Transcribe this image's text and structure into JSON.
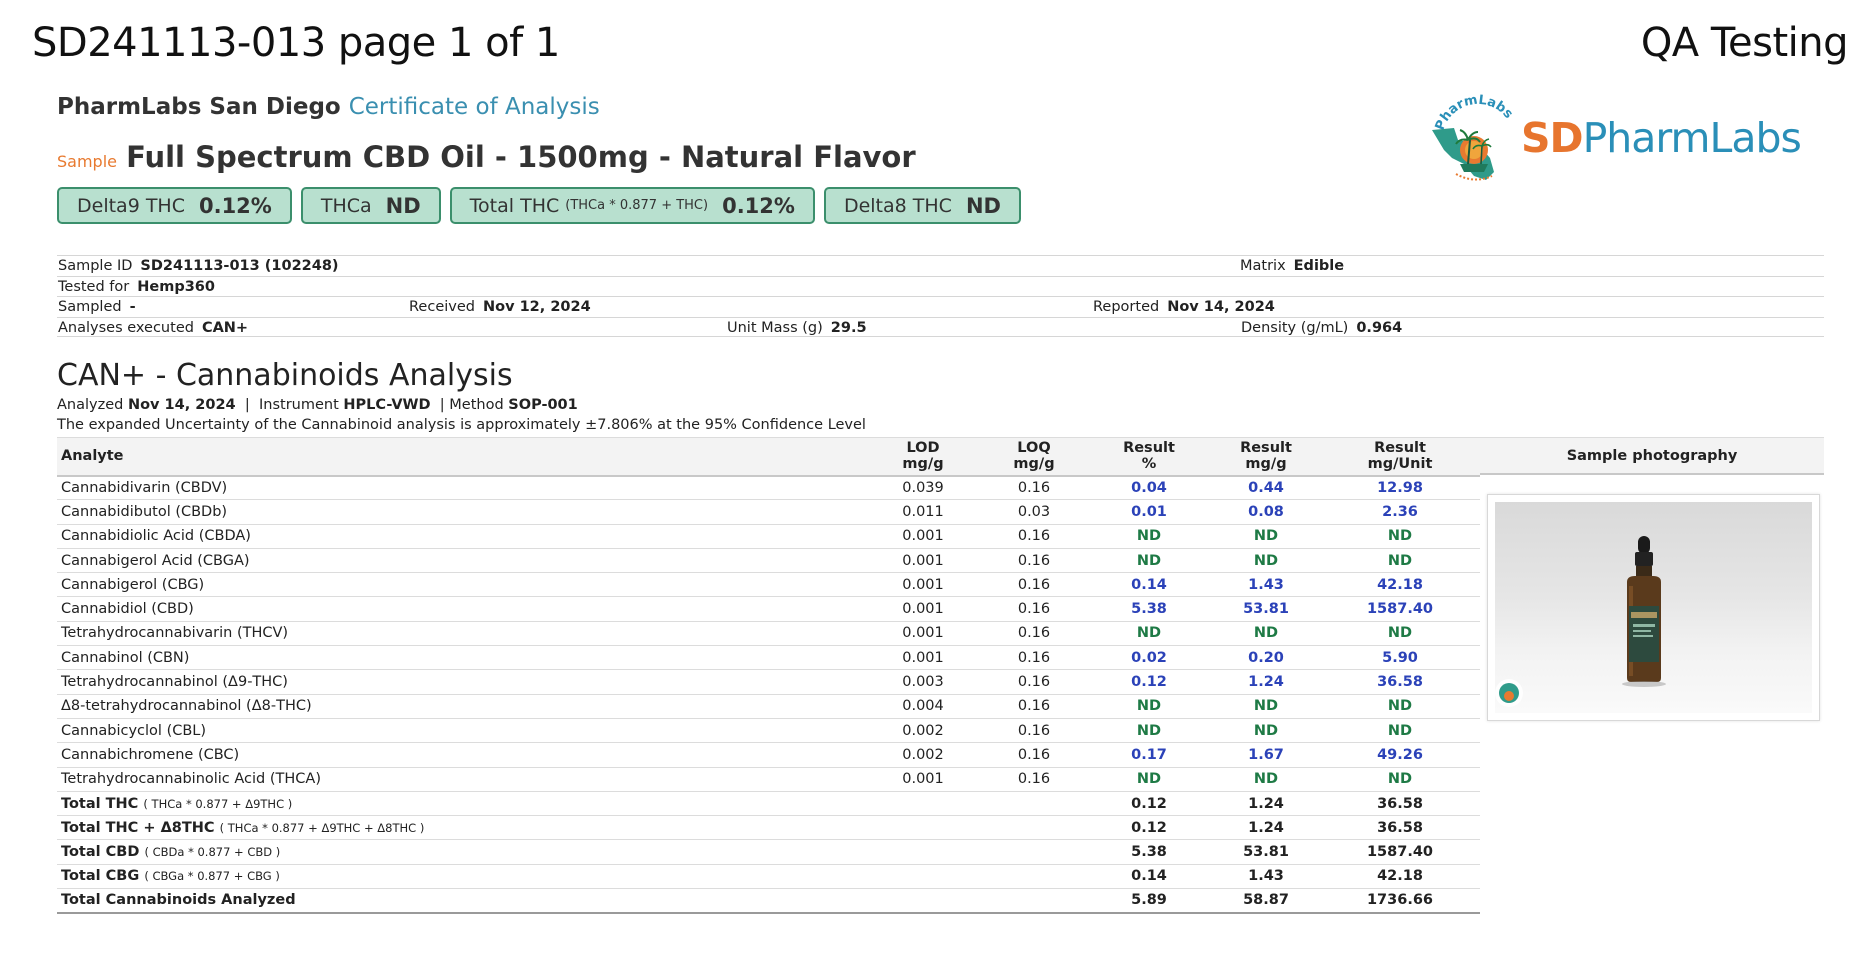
{
  "header": {
    "doc_title": "SD241113-013 page 1 of 1",
    "right_title": "QA Testing",
    "lab_name": "PharmLabs San Diego",
    "doc_type": "Certificate of Analysis",
    "sample_tag": "Sample",
    "sample_name": "Full Spectrum CBD Oil - 1500mg - Natural Flavor"
  },
  "logo": {
    "sd": "SD",
    "pharm": "PharmLabs",
    "arc_text": "PharmLabs"
  },
  "badges": [
    {
      "label": "Delta9 THC",
      "formula": "",
      "value": "0.12%"
    },
    {
      "label": "THCa",
      "formula": "",
      "value": "ND"
    },
    {
      "label": "Total THC",
      "formula": "(THCa * 0.877 + THC)",
      "value": "0.12%"
    },
    {
      "label": "Delta8 THC",
      "formula": "",
      "value": "ND"
    }
  ],
  "meta": {
    "sample_id_label": "Sample ID",
    "sample_id": "SD241113-013 (102248)",
    "matrix_label": "Matrix",
    "matrix": "Edible",
    "tested_for_label": "Tested for",
    "tested_for": "Hemp360",
    "sampled_label": "Sampled",
    "sampled": "-",
    "received_label": "Received",
    "received": "Nov 12, 2024",
    "reported_label": "Reported",
    "reported": "Nov 14, 2024",
    "analyses_label": "Analyses executed",
    "analyses": "CAN+",
    "unit_mass_label": "Unit Mass (g)",
    "unit_mass": "29.5",
    "density_label": "Density (g/mL)",
    "density": "0.964"
  },
  "analysis": {
    "title": "CAN+ - Cannabinoids Analysis",
    "analyzed_label": "Analyzed",
    "analyzed": "Nov 14, 2024",
    "instrument_label": "Instrument",
    "instrument": "HPLC-VWD",
    "method_label": "Method",
    "method": "SOP-001",
    "uncertainty_text": "The expanded Uncertainty of the Cannabinoid analysis is approximately ±7.806% at the 95% Confidence Level",
    "headers": {
      "analyte": "Analyte",
      "lod1": "LOD",
      "lod2": "mg/g",
      "loq1": "LOQ",
      "loq2": "mg/g",
      "rp1": "Result",
      "rp2": "%",
      "rg1": "Result",
      "rg2": "mg/g",
      "ru1": "Result",
      "ru2": "mg/Unit"
    },
    "photo_header": "Sample photography",
    "rows": [
      {
        "name": "Cannabidivarin (CBDV)",
        "lod": "0.039",
        "loq": "0.16",
        "pct": "0.04",
        "mgg": "0.44",
        "mgu": "12.98"
      },
      {
        "name": "Cannabidibutol (CBDb)",
        "lod": "0.011",
        "loq": "0.03",
        "pct": "0.01",
        "mgg": "0.08",
        "mgu": "2.36"
      },
      {
        "name": "Cannabidiolic Acid (CBDA)",
        "lod": "0.001",
        "loq": "0.16",
        "pct": "ND",
        "mgg": "ND",
        "mgu": "ND"
      },
      {
        "name": "Cannabigerol Acid (CBGA)",
        "lod": "0.001",
        "loq": "0.16",
        "pct": "ND",
        "mgg": "ND",
        "mgu": "ND"
      },
      {
        "name": "Cannabigerol (CBG)",
        "lod": "0.001",
        "loq": "0.16",
        "pct": "0.14",
        "mgg": "1.43",
        "mgu": "42.18"
      },
      {
        "name": "Cannabidiol (CBD)",
        "lod": "0.001",
        "loq": "0.16",
        "pct": "5.38",
        "mgg": "53.81",
        "mgu": "1587.40"
      },
      {
        "name": "Tetrahydrocannabivarin (THCV)",
        "lod": "0.001",
        "loq": "0.16",
        "pct": "ND",
        "mgg": "ND",
        "mgu": "ND"
      },
      {
        "name": "Cannabinol (CBN)",
        "lod": "0.001",
        "loq": "0.16",
        "pct": "0.02",
        "mgg": "0.20",
        "mgu": "5.90"
      },
      {
        "name": "Tetrahydrocannabinol (Δ9-THC)",
        "lod": "0.003",
        "loq": "0.16",
        "pct": "0.12",
        "mgg": "1.24",
        "mgu": "36.58"
      },
      {
        "name": "Δ8-tetrahydrocannabinol (Δ8-THC)",
        "lod": "0.004",
        "loq": "0.16",
        "pct": "ND",
        "mgg": "ND",
        "mgu": "ND"
      },
      {
        "name": "Cannabicyclol (CBL)",
        "lod": "0.002",
        "loq": "0.16",
        "pct": "ND",
        "mgg": "ND",
        "mgu": "ND"
      },
      {
        "name": "Cannabichromene (CBC)",
        "lod": "0.002",
        "loq": "0.16",
        "pct": "0.17",
        "mgg": "1.67",
        "mgu": "49.26"
      },
      {
        "name": "Tetrahydrocannabinolic Acid (THCA)",
        "lod": "0.001",
        "loq": "0.16",
        "pct": "ND",
        "mgg": "ND",
        "mgu": "ND"
      }
    ],
    "totals": [
      {
        "name": "Total THC",
        "formula": "( THCa * 0.877 + Δ9THC )",
        "pct": "0.12",
        "mgg": "1.24",
        "mgu": "36.58"
      },
      {
        "name": "Total THC + Δ8THC",
        "formula": "( THCa * 0.877 + Δ9THC + Δ8THC )",
        "pct": "0.12",
        "mgg": "1.24",
        "mgu": "36.58"
      },
      {
        "name": "Total CBD",
        "formula": "( CBDa * 0.877 + CBD )",
        "pct": "5.38",
        "mgg": "53.81",
        "mgu": "1587.40"
      },
      {
        "name": "Total CBG",
        "formula": "( CBGa * 0.877 + CBG )",
        "pct": "0.14",
        "mgg": "1.43",
        "mgu": "42.18"
      },
      {
        "name": "Total Cannabinoids Analyzed",
        "formula": "",
        "pct": "5.89",
        "mgg": "58.87",
        "mgu": "1736.66"
      }
    ]
  },
  "colors": {
    "result_blue": "#2b42b8",
    "nd_green": "#1e7a45",
    "badge_fill": "#b8e0cf",
    "badge_border": "#3b8f6c",
    "sample_orange": "#e87a30",
    "coa_blue": "#3a8fb0"
  }
}
